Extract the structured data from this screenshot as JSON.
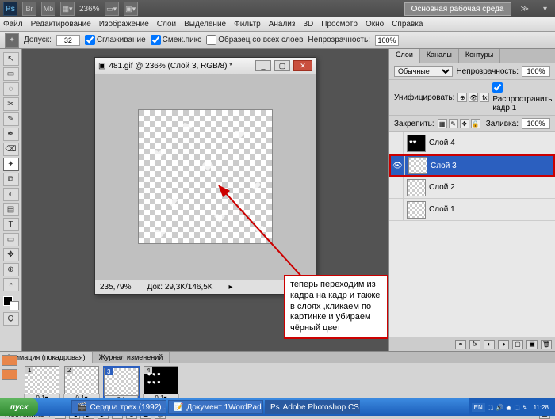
{
  "topbar": {
    "ps": "Ps",
    "zoom": "236%",
    "workspace": "Основная рабочая среда"
  },
  "menu": [
    "Файл",
    "Редактирование",
    "Изображение",
    "Слои",
    "Выделение",
    "Фильтр",
    "Анализ",
    "3D",
    "Просмотр",
    "Окно",
    "Справка"
  ],
  "opt": {
    "tolerance_label": "Допуск:",
    "tolerance": "32",
    "antialias": "Сглаживание",
    "contiguous": "Смеж.пикс",
    "allLayers": "Образец со всех слоев",
    "opacity_label": "Непрозрачность:",
    "opacity": "100%"
  },
  "doc": {
    "title": "481.gif @ 236% (Слой 3, RGB/8) *",
    "zoom": "235,79%",
    "status": "Док: 29,3K/146,5K"
  },
  "annotation": "теперь переходим из кадра на кадр и также в слоях ,кликаем по картинке и убираем чёрный цвет",
  "layersPanel": {
    "tabs": [
      "Слои",
      "Каналы",
      "Контуры"
    ],
    "blendMode": "Обычные",
    "opacity_label": "Непрозрачность:",
    "opacity": "100%",
    "unify_label": "Унифицировать:",
    "propagate": "Распространить кадр 1",
    "lock_label": "Закрепить:",
    "fill_label": "Заливка:",
    "fill": "100%",
    "layers": [
      {
        "name": "Слой 4",
        "sel": false,
        "black": true
      },
      {
        "name": "Слой 3",
        "sel": true,
        "black": false
      },
      {
        "name": "Слой 2",
        "sel": false,
        "black": false
      },
      {
        "name": "Слой 1",
        "sel": false,
        "black": false
      }
    ]
  },
  "anim": {
    "tabs": [
      "Анимация (покадровая)",
      "Журнал изменений"
    ],
    "loop": "Постоянно",
    "frames": [
      {
        "n": "1",
        "t": "0,1▾",
        "sel": false,
        "black": false
      },
      {
        "n": "2",
        "t": "0,1▾",
        "sel": false,
        "black": false
      },
      {
        "n": "3",
        "t": "0,1",
        "sel": true,
        "black": false
      },
      {
        "n": "4",
        "t": "0,1▾",
        "sel": false,
        "black": true
      }
    ]
  },
  "taskbar": {
    "start": "пуск",
    "items": [
      "Сердца трех (1992) ...",
      "Документ 1WordPad...",
      "Adobe Photoshop CS..."
    ],
    "lang": "EN",
    "clock": "11:28"
  },
  "tools": [
    "↖",
    "▭",
    "◌",
    "✂",
    "✎",
    "✒",
    "⌫",
    "✦",
    "⧉",
    "◐",
    "▤",
    "T",
    "▭",
    "✥",
    "⊕",
    "◔",
    "Q"
  ]
}
